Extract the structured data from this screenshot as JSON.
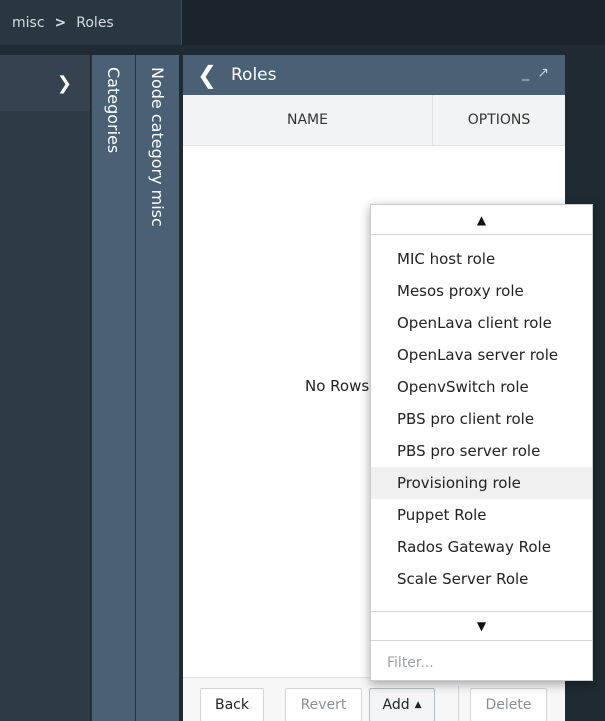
{
  "breadcrumb": {
    "items": [
      "misc",
      "Roles"
    ],
    "separator": ">"
  },
  "sidebar": {
    "expand_icon": "chevron-right-icon"
  },
  "vertical_tabs": [
    {
      "label": "Categories"
    },
    {
      "label": "Node category misc"
    }
  ],
  "panel": {
    "title": "Roles",
    "back_icon": "chevron-left-icon",
    "window_controls": [
      "minimize-icon",
      "expand-icon"
    ]
  },
  "table": {
    "columns": [
      "NAME",
      "OPTIONS"
    ],
    "empty_text": "No Rows"
  },
  "footer": {
    "back_label": "Back",
    "revert_label": "Revert",
    "add_label": "Add",
    "delete_label": "Delete"
  },
  "dropdown": {
    "items": [
      "MIC host role",
      "Mesos proxy role",
      "OpenLava client role",
      "OpenLava server role",
      "OpenvSwitch role",
      "PBS pro client role",
      "PBS pro server role",
      "Provisioning role",
      "Puppet Role",
      "Rados Gateway Role",
      "Scale Server Role"
    ],
    "hovered_item": "Provisioning role",
    "filter_placeholder": "Filter..."
  },
  "colors": {
    "background": "#1f2a33",
    "panel_header": "#4a6074",
    "vertical_tab": "#4a6074",
    "sidebar": "#2e3b46"
  }
}
